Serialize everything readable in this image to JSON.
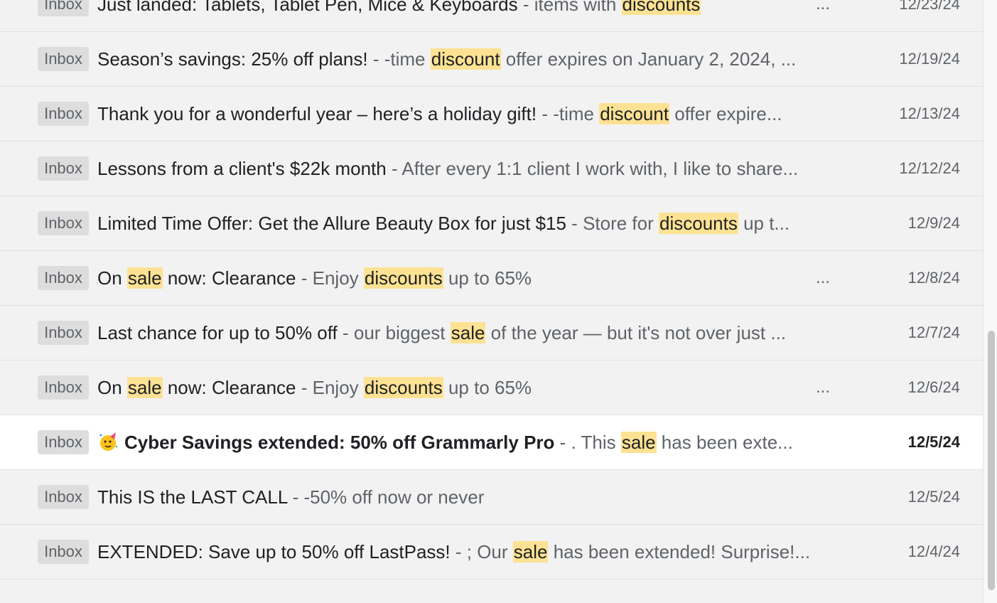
{
  "emails": [
    {
      "label": "Inbox",
      "parts": [
        {
          "t": "Just landed: Tablets, Tablet Pen, Mice & Keyboards",
          "c": "subject"
        },
        {
          "t": " - ",
          "c": "sep"
        },
        {
          "t": "items with ",
          "c": "snippet"
        },
        {
          "t": "discounts",
          "c": "hl"
        }
      ],
      "ellipsis": "...",
      "date": "12/23/24",
      "unread": false
    },
    {
      "label": "Inbox",
      "parts": [
        {
          "t": "Season’s savings: 25% off plans!",
          "c": "subject"
        },
        {
          "t": " - ",
          "c": "sep"
        },
        {
          "t": "-time ",
          "c": "snippet"
        },
        {
          "t": "discount",
          "c": "hl"
        },
        {
          "t": " offer expires on January 2, 2024, ...",
          "c": "snippet"
        }
      ],
      "ellipsis": "",
      "date": "12/19/24",
      "unread": false
    },
    {
      "label": "Inbox",
      "parts": [
        {
          "t": "Thank you for a wonderful year – here’s a holiday gift!",
          "c": "subject"
        },
        {
          "t": " - ",
          "c": "sep"
        },
        {
          "t": "-time ",
          "c": "snippet"
        },
        {
          "t": "discount",
          "c": "hl"
        },
        {
          "t": " offer expire...",
          "c": "snippet"
        }
      ],
      "ellipsis": "",
      "date": "12/13/24",
      "unread": false
    },
    {
      "label": "Inbox",
      "parts": [
        {
          "t": "Lessons from a client's $22k month",
          "c": "subject"
        },
        {
          "t": " - ",
          "c": "sep"
        },
        {
          "t": "After every 1:1 client I work with, I like to share...",
          "c": "snippet"
        }
      ],
      "ellipsis": "",
      "date": "12/12/24",
      "unread": false
    },
    {
      "label": "Inbox",
      "parts": [
        {
          "t": "Limited Time Offer: Get the Allure Beauty Box for just $15",
          "c": "subject"
        },
        {
          "t": " - ",
          "c": "sep"
        },
        {
          "t": "Store for ",
          "c": "snippet"
        },
        {
          "t": "discounts",
          "c": "hl"
        },
        {
          "t": " up t...",
          "c": "snippet"
        }
      ],
      "ellipsis": "",
      "date": "12/9/24",
      "unread": false
    },
    {
      "label": "Inbox",
      "parts": [
        {
          "t": "On ",
          "c": "subject"
        },
        {
          "t": "sale",
          "c": "hl"
        },
        {
          "t": " now: Clearance",
          "c": "subject"
        },
        {
          "t": " - ",
          "c": "sep"
        },
        {
          "t": "Enjoy ",
          "c": "snippet"
        },
        {
          "t": "discounts",
          "c": "hl"
        },
        {
          "t": " up to 65%",
          "c": "snippet"
        }
      ],
      "ellipsis": "...",
      "date": "12/8/24",
      "unread": false
    },
    {
      "label": "Inbox",
      "parts": [
        {
          "t": "Last chance for up to 50% off",
          "c": "subject"
        },
        {
          "t": " - ",
          "c": "sep"
        },
        {
          "t": "our biggest ",
          "c": "snippet"
        },
        {
          "t": "sale",
          "c": "hl"
        },
        {
          "t": " of the year — but it's not over just ...",
          "c": "snippet"
        }
      ],
      "ellipsis": "",
      "date": "12/7/24",
      "unread": false
    },
    {
      "label": "Inbox",
      "parts": [
        {
          "t": "On ",
          "c": "subject"
        },
        {
          "t": "sale",
          "c": "hl"
        },
        {
          "t": " now: Clearance",
          "c": "subject"
        },
        {
          "t": " - ",
          "c": "sep"
        },
        {
          "t": "Enjoy ",
          "c": "snippet"
        },
        {
          "t": "discounts",
          "c": "hl"
        },
        {
          "t": " up to 65%",
          "c": "snippet"
        }
      ],
      "ellipsis": "...",
      "date": "12/6/24",
      "unread": false
    },
    {
      "label": "Inbox",
      "emoji": "party-face-icon",
      "parts": [
        {
          "t": "Cyber Savings extended: 50% off Grammarly Pro",
          "c": "subject"
        },
        {
          "t": " - ",
          "c": "sep"
        },
        {
          "t": ". This ",
          "c": "snippet"
        },
        {
          "t": "sale",
          "c": "hl"
        },
        {
          "t": " has been exte...",
          "c": "snippet"
        }
      ],
      "ellipsis": "",
      "date": "12/5/24",
      "unread": true
    },
    {
      "label": "Inbox",
      "parts": [
        {
          "t": "This IS the LAST CALL",
          "c": "subject"
        },
        {
          "t": " - ",
          "c": "sep"
        },
        {
          "t": "-50% off now or never",
          "c": "snippet"
        }
      ],
      "ellipsis": "",
      "date": "12/5/24",
      "unread": false
    },
    {
      "label": "Inbox",
      "parts": [
        {
          "t": "EXTENDED: Save up to 50% off LastPass!",
          "c": "subject"
        },
        {
          "t": " - ",
          "c": "sep"
        },
        {
          "t": "; Our ",
          "c": "snippet"
        },
        {
          "t": "sale",
          "c": "hl"
        },
        {
          "t": " has been extended! Surprise!...",
          "c": "snippet"
        }
      ],
      "ellipsis": "",
      "date": "12/4/24",
      "unread": false
    }
  ],
  "colors": {
    "highlight": "#fde293",
    "unread_bg": "#ffffff",
    "read_bg": "#f2f2f2"
  }
}
